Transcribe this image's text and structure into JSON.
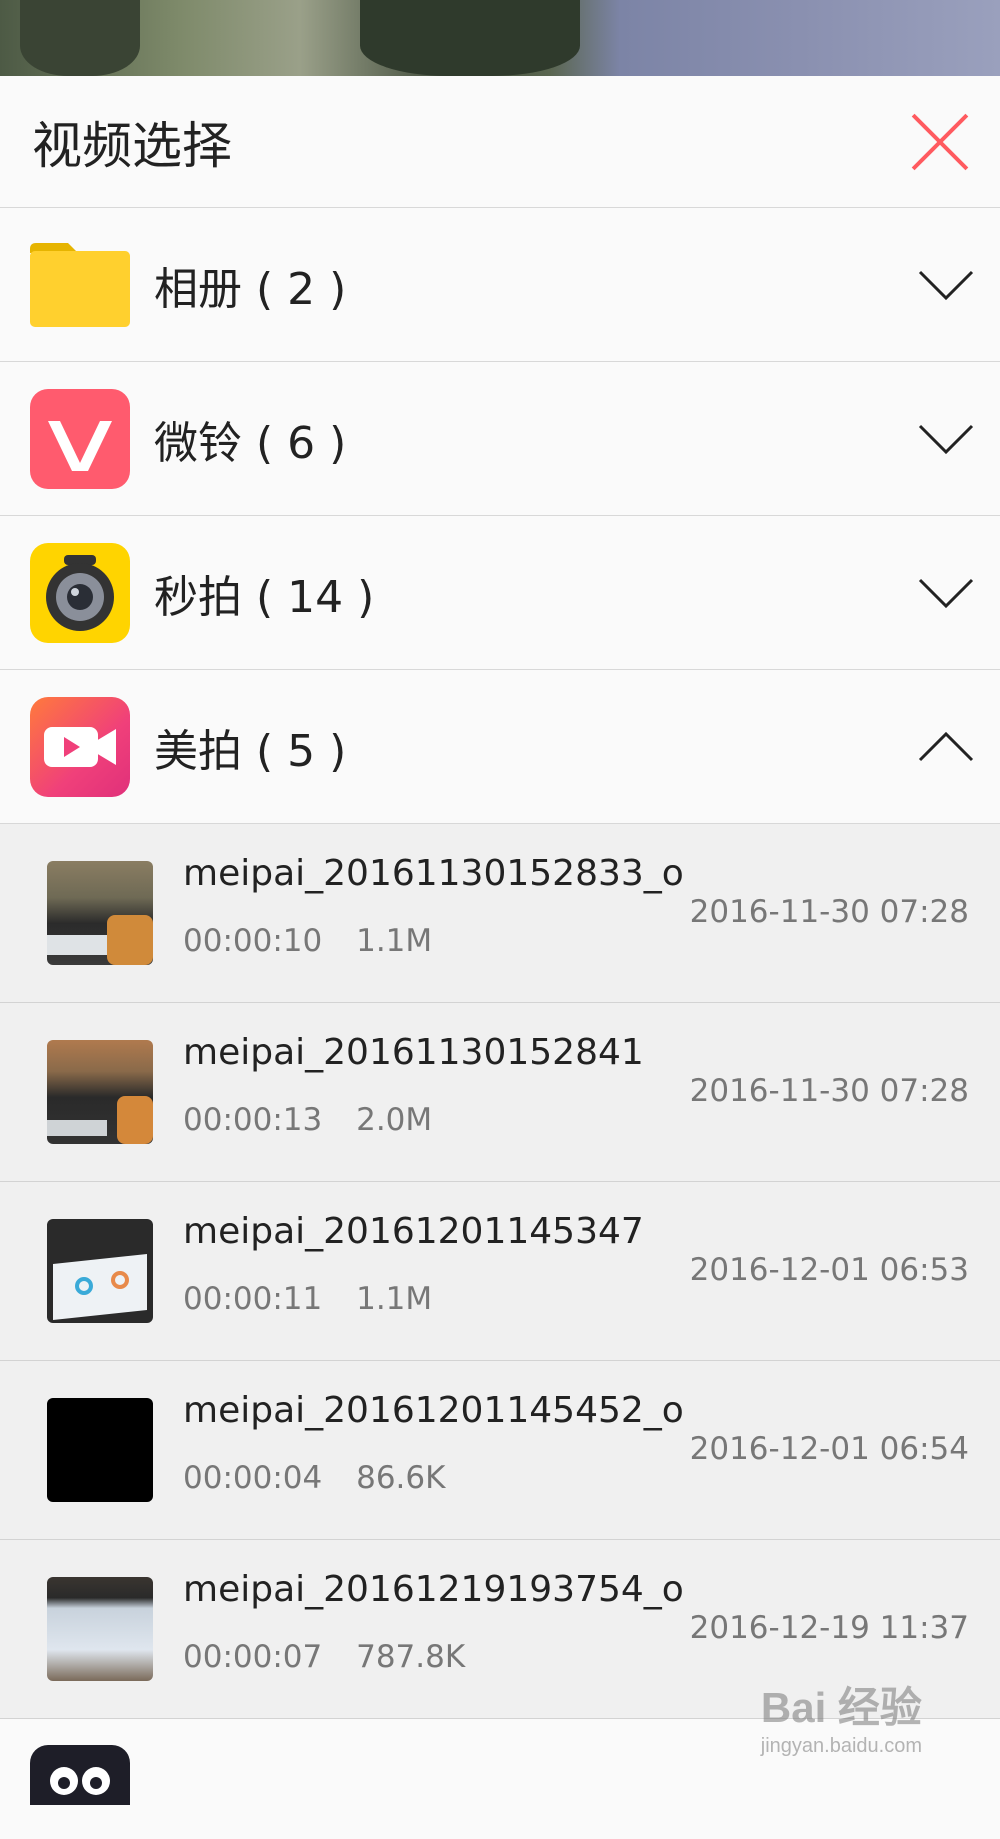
{
  "header": {
    "title": "视频选择",
    "close_icon": "close-icon",
    "accent": "#ff5a5f"
  },
  "groups": [
    {
      "label": "相册 ( 2 )",
      "icon": "folder-icon",
      "expanded": false
    },
    {
      "label": "微铃 ( 6 )",
      "icon": "weiling-app-icon",
      "expanded": false
    },
    {
      "label": "秒拍 ( 14 )",
      "icon": "miaopai-app-icon",
      "expanded": false
    },
    {
      "label": "美拍 ( 5 )",
      "icon": "meipai-app-icon",
      "expanded": true
    }
  ],
  "videos": [
    {
      "name": "meipai_20161130152833_o",
      "duration": "00:00:10",
      "size": "1.1M",
      "date": "2016-11-30 07:28"
    },
    {
      "name": "meipai_20161130152841",
      "duration": "00:00:13",
      "size": "2.0M",
      "date": "2016-11-30 07:28"
    },
    {
      "name": "meipai_20161201145347",
      "duration": "00:00:11",
      "size": "1.1M",
      "date": "2016-12-01 06:53"
    },
    {
      "name": "meipai_20161201145452_o",
      "duration": "00:00:04",
      "size": "86.6K",
      "date": "2016-12-01 06:54"
    },
    {
      "name": "meipai_20161219193754_o",
      "duration": "00:00:07",
      "size": "787.8K",
      "date": "2016-12-19 11:37"
    }
  ],
  "watermark": {
    "main": "Bai 经验",
    "sub": "jingyan.baidu.com"
  }
}
